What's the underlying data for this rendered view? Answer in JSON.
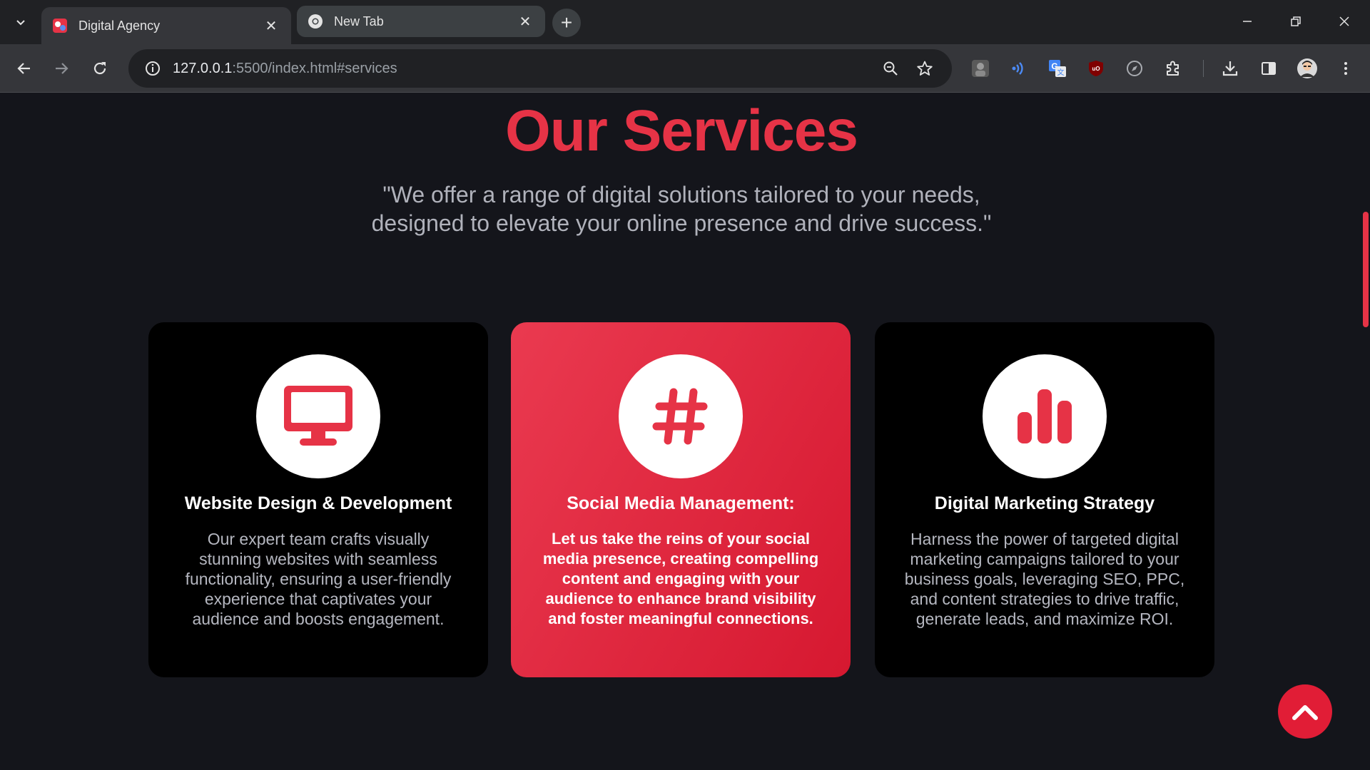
{
  "browser": {
    "tabs": [
      {
        "title": "Digital Agency",
        "active": true
      },
      {
        "title": "New Tab",
        "active": false
      }
    ],
    "url": {
      "host": "127.0.0.1",
      "rest": ":5500/index.html#services"
    }
  },
  "services": {
    "title": "Our Services",
    "subtitle_line1": "\"We offer a range of digital solutions tailored to your needs,",
    "subtitle_line2": "designed to elevate your online presence and drive success.\"",
    "cards": [
      {
        "icon": "desktop-icon",
        "title": "Website Design & Development",
        "text": "Our expert team crafts visually stunning websites with seamless functionality, ensuring a user-friendly experience that captivates your audience and boosts engagement."
      },
      {
        "icon": "hashtag-icon",
        "title": "Social Media Management:",
        "text": "Let us take the reins of your social media presence, creating compelling content and engaging with your audience to enhance brand visibility and foster meaningful connections."
      },
      {
        "icon": "bar-chart-icon",
        "title": "Digital Marketing Strategy",
        "text": "Harness the power of targeted digital marketing campaigns tailored to your business goals, leveraging SEO, PPC, and content strategies to drive traffic, generate leads, and maximize ROI."
      }
    ]
  },
  "colors": {
    "accent": "#e63346",
    "page_bg": "#14151b",
    "card_bg": "#000000",
    "highlight_card_start": "#ea3a50",
    "highlight_card_end": "#d61830"
  }
}
